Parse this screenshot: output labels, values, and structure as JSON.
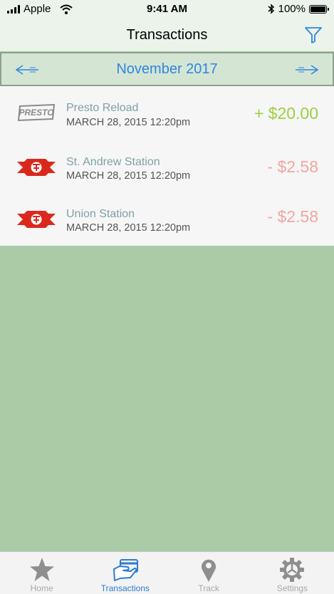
{
  "status_bar": {
    "carrier": "Apple",
    "time": "9:41 AM",
    "battery": "100%",
    "icons": [
      "signal-icon",
      "wifi-icon",
      "bluetooth-icon",
      "battery-icon"
    ]
  },
  "header": {
    "title": "Transactions",
    "filter_icon": "filter-icon"
  },
  "month_selector": {
    "label": "November 2017",
    "prev_icon": "arrow-left-icon",
    "next_icon": "arrow-right-icon"
  },
  "transactions": [
    {
      "logo": "presto-logo",
      "logo_text": "PRESTO",
      "name": "Presto Reload",
      "date": "MARCH 28, 2015 12:20pm",
      "amount": "+ $20.00",
      "type": "credit"
    },
    {
      "logo": "ttc-logo",
      "name": "St. Andrew Station",
      "date": "MARCH 28, 2015 12:20pm",
      "amount": "- $2.58",
      "type": "debit"
    },
    {
      "logo": "ttc-logo",
      "name": "Union Station",
      "date": "MARCH 28, 2015 12:20pm",
      "amount": "- $2.58",
      "type": "debit"
    }
  ],
  "tab_bar": {
    "active": "Transactions",
    "tabs": [
      {
        "label": "Home",
        "icon": "star-icon"
      },
      {
        "label": "Transactions",
        "icon": "card-icon"
      },
      {
        "label": "Track",
        "icon": "location-pin-icon"
      },
      {
        "label": "Settings",
        "icon": "gear-icon"
      }
    ]
  },
  "colors": {
    "accent": "#2e86de",
    "credit": "#9cd03f",
    "debit": "#f1a7a0",
    "background": "#a9cba6",
    "ttc_red": "#da291c"
  }
}
